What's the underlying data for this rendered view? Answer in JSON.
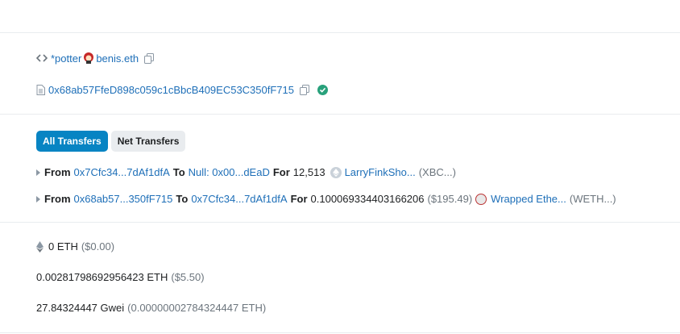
{
  "ens": {
    "prefix": "*potter",
    "suffix": "benis.eth"
  },
  "contract": {
    "address": "0x68ab57FfeD898c059c1cBbcB409EC53C350fF715"
  },
  "tabs": {
    "all": "All Transfers",
    "net": "Net Transfers"
  },
  "transfers": [
    {
      "from_label": "From",
      "from": "0x7Cfc34...7dAf1dfA",
      "to_label": "To",
      "to": "Null: 0x00...dEaD",
      "for_label": "For",
      "amount": "12,513",
      "usd": "",
      "token_name": "LarryFinkSho...",
      "token_symbol": "(XBC...)"
    },
    {
      "from_label": "From",
      "from": "0x68ab57...350fF715",
      "to_label": "To",
      "to": "0x7Cfc34...7dAf1dfA",
      "for_label": "For",
      "amount": "0.100069334403166206",
      "usd": "($195.49)",
      "token_name": "Wrapped Ethe...",
      "token_symbol": "(WETH...)"
    }
  ],
  "value": {
    "eth": "0 ETH",
    "usd": "($0.00)"
  },
  "fee": {
    "eth": "0.00281798692956423 ETH",
    "usd": "($5.50)"
  },
  "gas_price": {
    "gwei": "27.84324447 Gwei",
    "eth": "(0.00000002784324447 ETH)"
  },
  "colors": {
    "link": "#1e6fb8",
    "active_tab": "#0784c3",
    "verified": "#28a17b"
  }
}
